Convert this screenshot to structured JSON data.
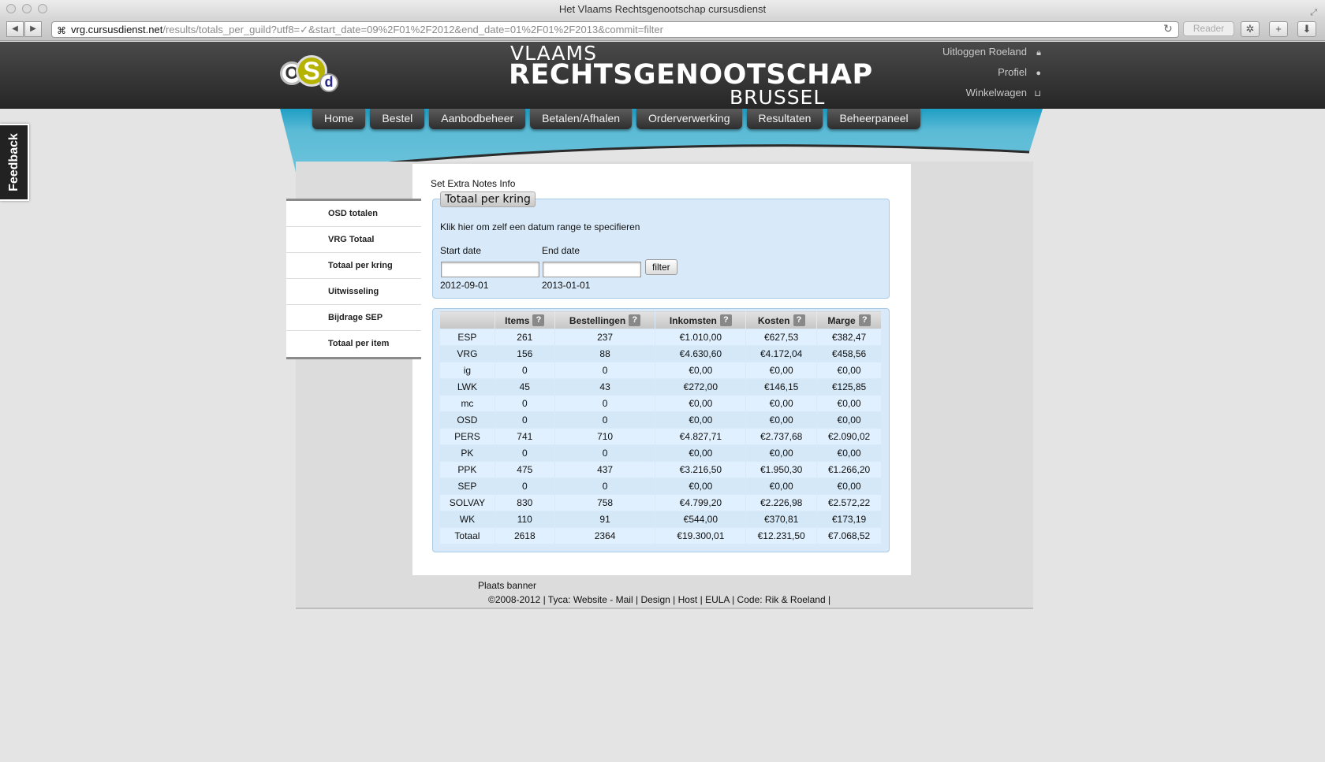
{
  "browser": {
    "title": "Het Vlaams Rechtsgenootschap cursusdienst",
    "url_host": "vrg.cursusdienst.net",
    "url_path": "/results/totals_per_guild?utf8=✓&start_date=09%2F01%2F2012&end_date=01%2F01%2F2013&commit=filter",
    "reader_label": "Reader"
  },
  "header": {
    "logo": {
      "o": "O",
      "s": "S",
      "d": "d"
    },
    "brand_line1": "VLAAMS",
    "brand_line2": "RECHTSGENOOTSCHAP",
    "brand_line3": "BRUSSEL",
    "user_links": {
      "logout": "Uitloggen Roeland",
      "profile": "Profiel",
      "cart": "Winkelwagen"
    }
  },
  "nav": {
    "tabs": [
      "Home",
      "Bestel",
      "Aanbodbeheer",
      "Betalen/Afhalen",
      "Orderverwerking",
      "Resultaten",
      "Beheerpaneel"
    ]
  },
  "feedback_label": "Feedback",
  "side_menu": {
    "items": [
      "OSD totalen",
      "VRG Totaal",
      "Totaal per kring",
      "Uitwisseling",
      "Bijdrage SEP",
      "Totaal per item"
    ]
  },
  "main": {
    "notes_link": "Set Extra Notes Info",
    "legend": "Totaal per kring",
    "range_link": "Klik hier om zelf een datum range te specifieren",
    "start_label": "Start date",
    "end_label": "End date",
    "start_value": "",
    "end_value": "",
    "filter_button": "filter",
    "start_display": "2012-09-01",
    "end_display": "2013-01-01"
  },
  "table": {
    "headers": [
      "",
      "Items",
      "Bestellingen",
      "Inkomsten",
      "Kosten",
      "Marge"
    ],
    "help_glyph": "?",
    "rows": [
      [
        "ESP",
        "261",
        "237",
        "€1.010,00",
        "€627,53",
        "€382,47"
      ],
      [
        "VRG",
        "156",
        "88",
        "€4.630,60",
        "€4.172,04",
        "€458,56"
      ],
      [
        "ig",
        "0",
        "0",
        "€0,00",
        "€0,00",
        "€0,00"
      ],
      [
        "LWK",
        "45",
        "43",
        "€272,00",
        "€146,15",
        "€125,85"
      ],
      [
        "mc",
        "0",
        "0",
        "€0,00",
        "€0,00",
        "€0,00"
      ],
      [
        "OSD",
        "0",
        "0",
        "€0,00",
        "€0,00",
        "€0,00"
      ],
      [
        "PERS",
        "741",
        "710",
        "€4.827,71",
        "€2.737,68",
        "€2.090,02"
      ],
      [
        "PK",
        "0",
        "0",
        "€0,00",
        "€0,00",
        "€0,00"
      ],
      [
        "PPK",
        "475",
        "437",
        "€3.216,50",
        "€1.950,30",
        "€1.266,20"
      ],
      [
        "SEP",
        "0",
        "0",
        "€0,00",
        "€0,00",
        "€0,00"
      ],
      [
        "SOLVAY",
        "830",
        "758",
        "€4.799,20",
        "€2.226,98",
        "€2.572,22"
      ],
      [
        "WK",
        "110",
        "91",
        "€544,00",
        "€370,81",
        "€173,19"
      ],
      [
        "Totaal",
        "2618",
        "2364",
        "€19.300,01",
        "€12.231,50",
        "€7.068,52"
      ]
    ]
  },
  "footer": {
    "banner": "Plaats banner",
    "copy_prefix": "©2008-2012 | Tyca: ",
    "links": [
      "Website",
      "Mail",
      "Design",
      "Host",
      "EULA"
    ],
    "seps": [
      " - ",
      " | ",
      " | ",
      " | "
    ],
    "copy_suffix": " | Code: Rik & Roeland |"
  }
}
